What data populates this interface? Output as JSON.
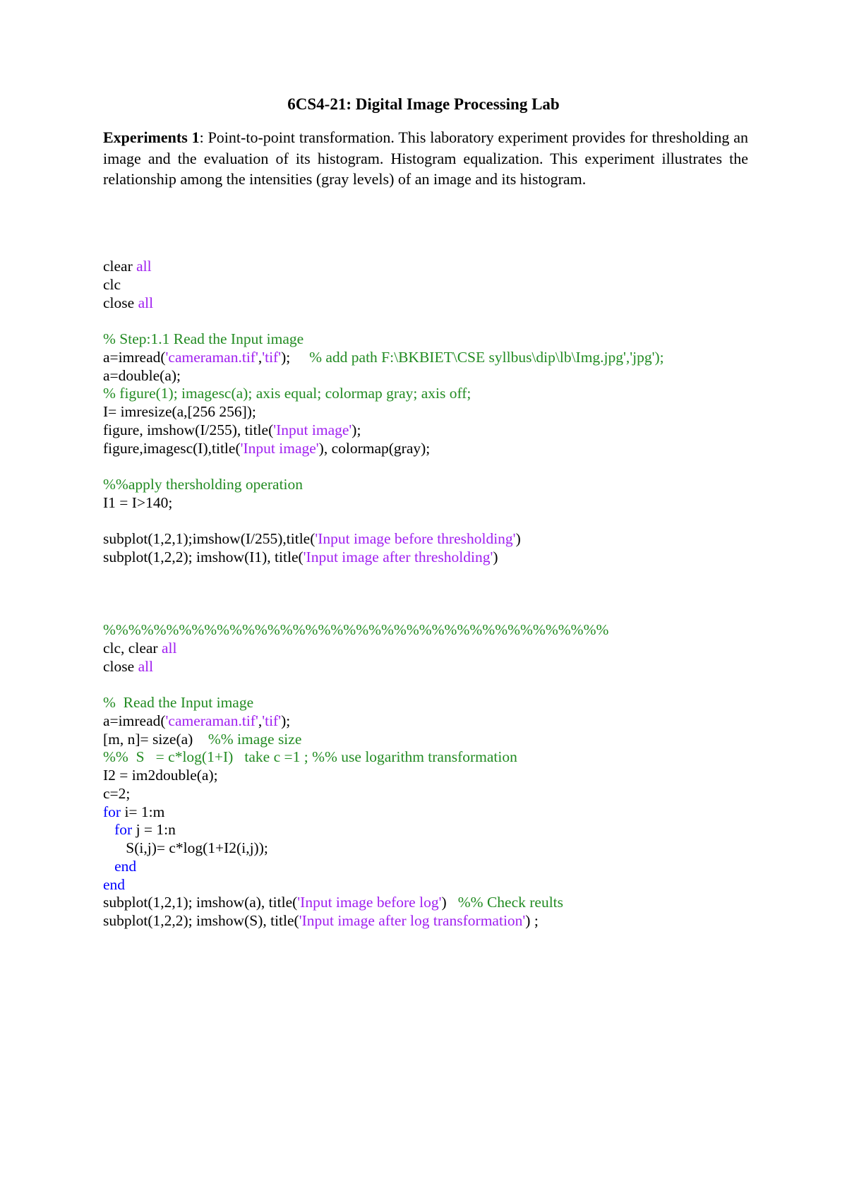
{
  "document": {
    "title": "6CS4-21: Digital Image Processing Lab",
    "intro": {
      "lead": "Experiments 1",
      "colon": ":",
      "body": "  Point-to-point transformation. This laboratory experiment provides for thresholding an image and the evaluation of its histogram. Histogram equalization. This experiment illustrates the relationship among the intensities (gray levels) of an image and its histogram."
    },
    "syntax_colors": {
      "keyword": "#0000FF",
      "string": "#A020F0",
      "comment": "#228B22",
      "text": "#000000"
    },
    "code_lines": [
      [
        {
          "t": "tx",
          "v": "clear "
        },
        {
          "t": "str",
          "v": "all"
        }
      ],
      [
        {
          "t": "tx",
          "v": "clc"
        }
      ],
      [
        {
          "t": "tx",
          "v": "close "
        },
        {
          "t": "str",
          "v": "all"
        }
      ],
      [],
      [
        {
          "t": "cm",
          "v": "% Step:1.1 Read the Input image"
        }
      ],
      [
        {
          "t": "tx",
          "v": "a=imread("
        },
        {
          "t": "str",
          "v": "'cameraman.tif'"
        },
        {
          "t": "tx",
          "v": ","
        },
        {
          "t": "str",
          "v": "'tif'"
        },
        {
          "t": "tx",
          "v": ");     "
        },
        {
          "t": "cm",
          "v": "% add path F:\\BKBIET\\CSE syllbus\\dip\\lb\\Img.jpg','jpg');"
        }
      ],
      [
        {
          "t": "tx",
          "v": "a=double(a);"
        }
      ],
      [
        {
          "t": "cm",
          "v": "% figure(1); imagesc(a); axis equal; colormap gray; axis off;"
        }
      ],
      [
        {
          "t": "tx",
          "v": "I= imresize(a,[256 256]);"
        }
      ],
      [
        {
          "t": "tx",
          "v": "figure, imshow(I/255), title("
        },
        {
          "t": "str",
          "v": "'Input image'"
        },
        {
          "t": "tx",
          "v": ");"
        }
      ],
      [
        {
          "t": "tx",
          "v": "figure,imagesc(I),title("
        },
        {
          "t": "str",
          "v": "'Input image'"
        },
        {
          "t": "tx",
          "v": "), colormap(gray);"
        }
      ],
      [],
      [
        {
          "t": "cm",
          "v": "%%apply thersholding operation"
        }
      ],
      [
        {
          "t": "tx",
          "v": "I1 = I>140;"
        }
      ],
      [],
      [
        {
          "t": "tx",
          "v": "subplot(1,2,1);imshow(I/255),title("
        },
        {
          "t": "str",
          "v": "'Input image before thresholding'"
        },
        {
          "t": "tx",
          "v": ")"
        }
      ],
      [
        {
          "t": "tx",
          "v": "subplot(1,2,2); imshow(I1), title("
        },
        {
          "t": "str",
          "v": "'Input image after thresholding'"
        },
        {
          "t": "tx",
          "v": ")"
        }
      ],
      [],
      [],
      [],
      [
        {
          "t": "cm",
          "v": "%%%%%%%%%%%%%%%%%%%%%%%%%%%%%%%%%%%%%%%%"
        }
      ],
      [
        {
          "t": "tx",
          "v": "clc, clear "
        },
        {
          "t": "str",
          "v": "all"
        }
      ],
      [
        {
          "t": "tx",
          "v": "close "
        },
        {
          "t": "str",
          "v": "all"
        }
      ],
      [],
      [
        {
          "t": "cm",
          "v": "%  Read the Input image"
        }
      ],
      [
        {
          "t": "tx",
          "v": "a=imread("
        },
        {
          "t": "str",
          "v": "'cameraman.tif'"
        },
        {
          "t": "tx",
          "v": ","
        },
        {
          "t": "str",
          "v": "'tif'"
        },
        {
          "t": "tx",
          "v": ");"
        }
      ],
      [
        {
          "t": "tx",
          "v": "[m, n]= size(a)    "
        },
        {
          "t": "cm",
          "v": "%% image size"
        }
      ],
      [
        {
          "t": "cm",
          "v": "%%  S   = c*log(1+I)   take c =1 ; %% use logarithm transformation"
        }
      ],
      [
        {
          "t": "tx",
          "v": "I2 = im2double(a);"
        }
      ],
      [
        {
          "t": "tx",
          "v": "c=2;"
        }
      ],
      [
        {
          "t": "kw",
          "v": "for"
        },
        {
          "t": "tx",
          "v": " i= 1:m"
        }
      ],
      [
        {
          "t": "tx",
          "v": "   "
        },
        {
          "t": "kw",
          "v": "for"
        },
        {
          "t": "tx",
          "v": " j = 1:n"
        }
      ],
      [
        {
          "t": "tx",
          "v": "      S(i,j)= c*log(1+I2(i,j));"
        }
      ],
      [
        {
          "t": "tx",
          "v": "   "
        },
        {
          "t": "kw",
          "v": "end"
        }
      ],
      [
        {
          "t": "kw",
          "v": "end"
        }
      ],
      [
        {
          "t": "tx",
          "v": "subplot(1,2,1); imshow(a), title("
        },
        {
          "t": "str",
          "v": "'Input image before log'"
        },
        {
          "t": "tx",
          "v": ")   "
        },
        {
          "t": "cm",
          "v": "%% Check reults"
        }
      ],
      [
        {
          "t": "tx",
          "v": "subplot(1,2,2); imshow(S), title("
        },
        {
          "t": "str",
          "v": "'Input image after log transformation'"
        },
        {
          "t": "tx",
          "v": ") ;"
        }
      ]
    ]
  }
}
